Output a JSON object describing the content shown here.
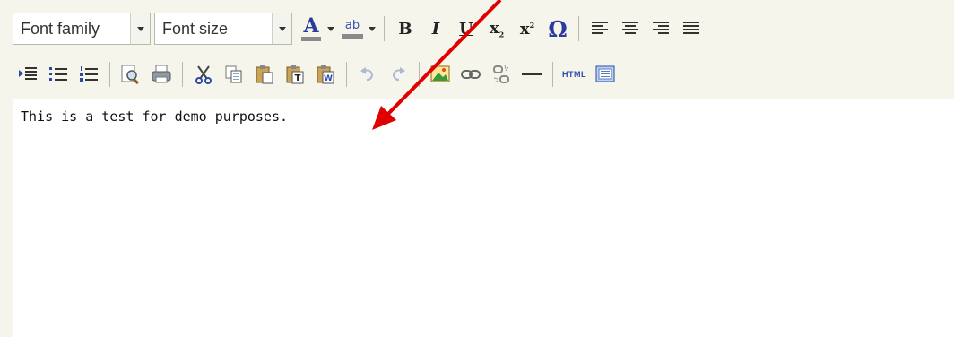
{
  "toolbar": {
    "font_family_label": "Font family",
    "font_size_label": "Font size",
    "bold": "B",
    "italic": "I",
    "underline": "U",
    "subscript": "x",
    "superscript": "x",
    "special_char": "Ω",
    "color_letter": "A",
    "highlight_text": "ab",
    "html_label": "HTML"
  },
  "editor": {
    "content": "This is a test for demo purposes."
  },
  "colors": {
    "background": "#f5f5ec",
    "annotation_arrow": "#e00000",
    "text_color_icon": "#2b3a9c"
  },
  "icons": [
    "text-color-icon",
    "highlight-color-icon",
    "bold-icon",
    "italic-icon",
    "underline-icon",
    "subscript-icon",
    "superscript-icon",
    "special-character-icon",
    "align-left-icon",
    "align-center-icon",
    "align-right-icon",
    "justify-icon",
    "indent-icon",
    "bullet-list-icon",
    "numbered-list-icon",
    "preview-icon",
    "print-icon",
    "cut-icon",
    "copy-icon",
    "paste-icon",
    "paste-text-icon",
    "paste-word-icon",
    "undo-icon",
    "redo-icon",
    "insert-image-icon",
    "link-icon",
    "unlink-icon",
    "horizontal-rule-icon",
    "html-source-icon",
    "template-icon"
  ]
}
